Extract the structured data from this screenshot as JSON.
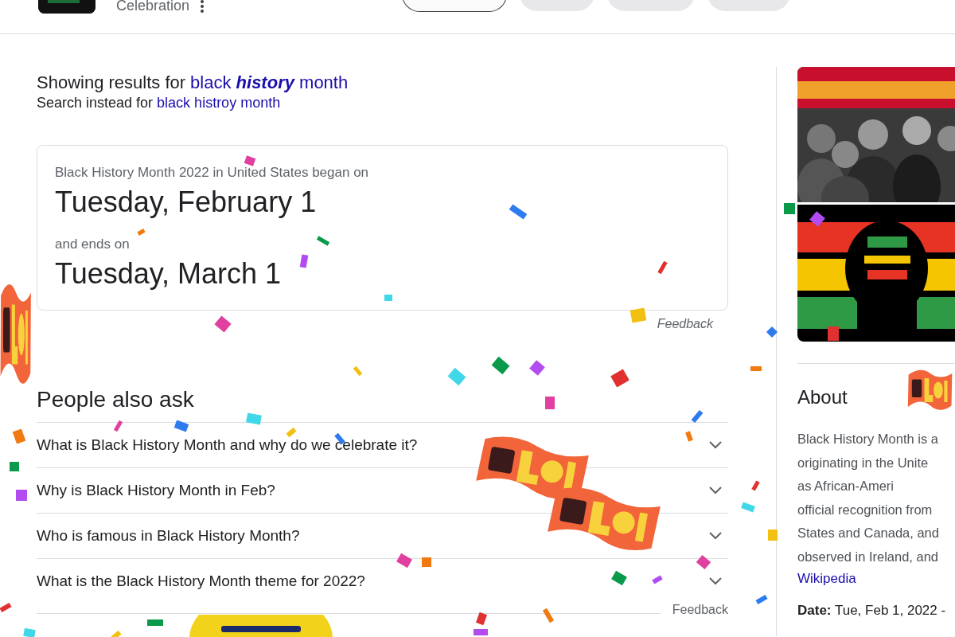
{
  "header": {
    "title": "Celebration",
    "chips": [
      {
        "selected": true
      },
      {
        "selected": false
      },
      {
        "selected": false
      },
      {
        "selected": false
      }
    ]
  },
  "spelling": {
    "showing_label": "Showing results for",
    "corrected": "black **history** month",
    "instead_label": "Search instead for",
    "original": "black histroy month"
  },
  "answer": {
    "caption": "Black History Month 2022 in United States began on",
    "start": "Tuesday, February 1",
    "end_caption": "and ends on",
    "end": "Tuesday, March 1",
    "feedback": "Feedback"
  },
  "people_also_ask": {
    "title": "People also ask",
    "questions": [
      {
        "text": "What is Black History Month and why do we celebrate it?",
        "expanded": false
      },
      {
        "text": "Why is Black History Month in Feb?",
        "expanded": false
      },
      {
        "text": "Who is famous in Black History Month?",
        "expanded": false
      },
      {
        "text": "What is the Black History Month theme for 2022?",
        "expanded": false
      }
    ],
    "feedback": "Feedback"
  },
  "side": {
    "about_title": "About",
    "about_lines": [
      "Black History Month is a",
      "originating in the Unite",
      "as African-Ameri",
      "official recognition from",
      "States and Canada, and",
      "observed in Ireland, and"
    ],
    "source": "Wikipedia",
    "date": "**Date:** Tue, Feb 1, 2022 -"
  }
}
